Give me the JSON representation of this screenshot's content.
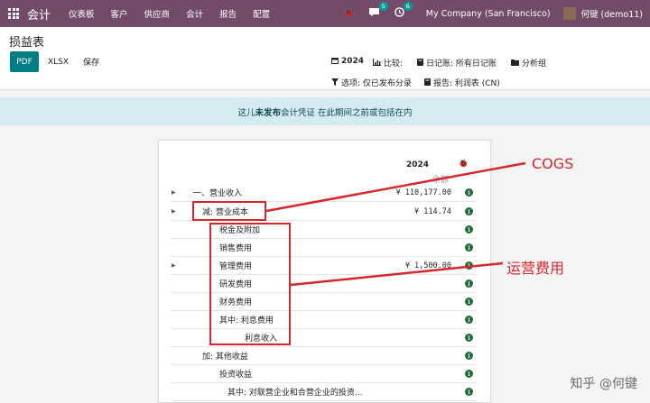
{
  "navbar": {
    "app_name": "会计",
    "menu": [
      "仪表板",
      "客户",
      "供应商",
      "会计",
      "报告",
      "配置"
    ],
    "bug_icon": "🐞",
    "chat_count": "5",
    "activity_count": "6",
    "company": "My Company (San Francisco)",
    "user": "何键 (demo11)"
  },
  "control": {
    "title": "损益表",
    "buttons": {
      "pdf": "PDF",
      "xlsx": "XLSX",
      "save": "保存"
    },
    "filters": {
      "period": "2024",
      "compare": "比较:",
      "journal": "日记账: 所有日记账",
      "analytic": "分析组",
      "options": "选项: 仅已发布分录",
      "report": "报告: 利润表 (CN)"
    }
  },
  "alert": {
    "text_prefix": "这儿",
    "text_emph": "未发布",
    "text_suffix": "会计凭证 在此期间之前或包括在内"
  },
  "report": {
    "column_year": "2024",
    "column_sub": "余额",
    "rows": [
      {
        "label": "一、营业收入",
        "amount": "¥ 110,177.00",
        "expandable": true
      },
      {
        "label": "减: 营业成本",
        "amount": "¥ 114.74",
        "expandable": true
      },
      {
        "label": "税金及附加",
        "amount": "",
        "expandable": false
      },
      {
        "label": "销售费用",
        "amount": "",
        "expandable": false
      },
      {
        "label": "管理费用",
        "amount": "¥ 1,500.00",
        "expandable": true
      },
      {
        "label": "研发费用",
        "amount": "",
        "expandable": false
      },
      {
        "label": "财务费用",
        "amount": "",
        "expandable": false
      },
      {
        "label": "其中: 利息费用",
        "amount": "",
        "expandable": false
      },
      {
        "label": "利息收入",
        "amount": "",
        "expandable": false
      },
      {
        "label": "加: 其他收益",
        "amount": "",
        "expandable": false
      },
      {
        "label": "投资收益",
        "amount": "",
        "expandable": false
      },
      {
        "label": "其中: 对联营企业和合营企业的投资...",
        "amount": "",
        "expandable": false
      }
    ]
  },
  "annotations": {
    "cogs": "COGS",
    "opex": "运营费用",
    "color": "#d7262c"
  },
  "watermark": "知乎 @何键"
}
